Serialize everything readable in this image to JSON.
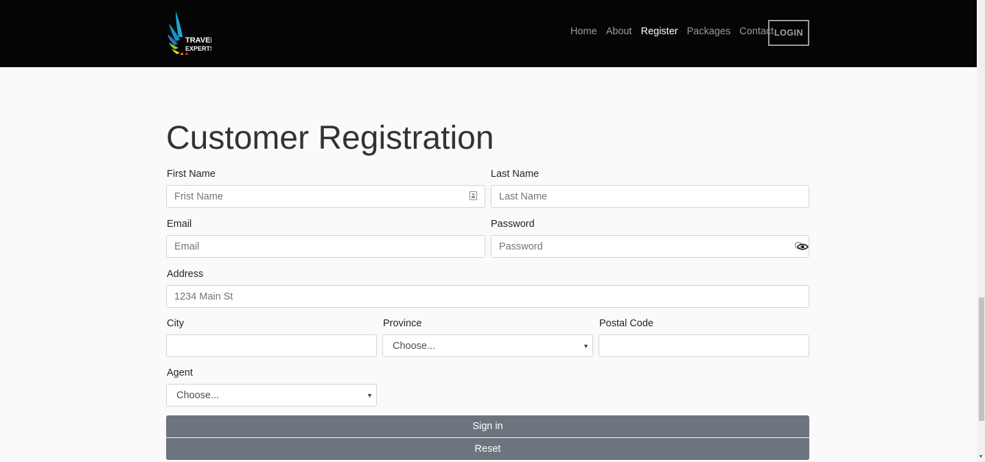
{
  "header": {
    "logo_text_line1": "TRAVEL",
    "logo_text_line2": "EXPERTS",
    "nav": [
      {
        "label": "Home",
        "active": false
      },
      {
        "label": "About",
        "active": false
      },
      {
        "label": "Register",
        "active": true
      },
      {
        "label": "Packages",
        "active": false
      },
      {
        "label": "Contact",
        "active": false
      }
    ],
    "login_label": "LOGIN"
  },
  "form": {
    "title": "Customer Registration",
    "first_name": {
      "label": "First Name",
      "placeholder": "Frist Name",
      "value": ""
    },
    "last_name": {
      "label": "Last Name",
      "placeholder": "Last Name",
      "value": ""
    },
    "email": {
      "label": "Email",
      "placeholder": "Email",
      "value": ""
    },
    "password": {
      "label": "Password",
      "placeholder": "Password",
      "value": ""
    },
    "address": {
      "label": "Address",
      "placeholder": "1234 Main St",
      "value": ""
    },
    "city": {
      "label": "City",
      "placeholder": "",
      "value": ""
    },
    "province": {
      "label": "Province",
      "selected": "Choose..."
    },
    "postal_code": {
      "label": "Postal Code",
      "placeholder": "",
      "value": ""
    },
    "agent": {
      "label": "Agent",
      "selected": "Choose..."
    },
    "sign_in_label": "Sign in",
    "reset_label": "Reset"
  },
  "colors": {
    "navbar_bg": "#050505",
    "page_bg": "#fbf9fa",
    "button_bg": "#6c757d",
    "nav_active": "#ffffff",
    "nav_inactive": "#9a9a9a"
  },
  "icons": [
    "travel-experts-logo",
    "contact-card-icon",
    "eye-icon",
    "chevron-down-icon"
  ]
}
